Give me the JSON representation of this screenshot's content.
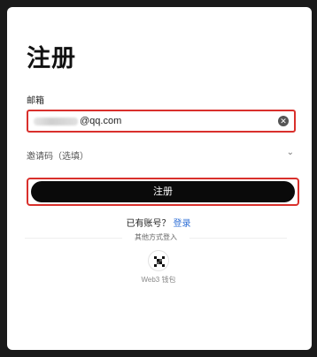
{
  "page": {
    "title": "注册"
  },
  "email": {
    "label": "邮箱",
    "value": "@qq.com",
    "clear_icon": "close-circle-icon"
  },
  "invite": {
    "label": "邀请码（选填）",
    "chevron_icon": "chevron-down-icon",
    "chevron_glyph": "⌄"
  },
  "register_button": {
    "label": "注册"
  },
  "login_prompt": {
    "text": "已有账号？",
    "link": "登录"
  },
  "other_methods": {
    "divider_text": "其他方式登入",
    "web3_icon": "web3-wallet-icon",
    "web3_label": "Web3 钱包"
  },
  "colors": {
    "accent_red": "#d9302c",
    "link_blue": "#2f6fd6",
    "button_bg": "#0a0a0a"
  }
}
